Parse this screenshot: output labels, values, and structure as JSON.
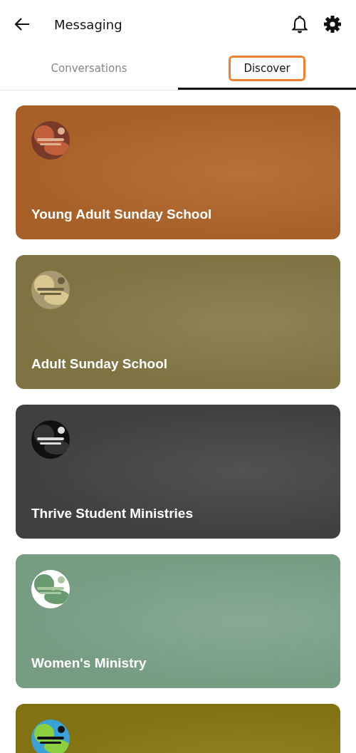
{
  "header": {
    "title": "Messaging"
  },
  "tabs": [
    {
      "label": "Conversations",
      "selected": false,
      "highlighted": false
    },
    {
      "label": "Discover",
      "selected": true,
      "highlighted": true
    }
  ],
  "groups": [
    {
      "name": "Young Adult Sunday School",
      "color": "#b0652a"
    },
    {
      "name": "Adult Sunday School",
      "color": "#857945"
    },
    {
      "name": "Thrive Student Ministries",
      "color": "#434343"
    },
    {
      "name": "Women's Ministry",
      "color": "#7ca489"
    },
    {
      "color": "#8a7812"
    }
  ]
}
